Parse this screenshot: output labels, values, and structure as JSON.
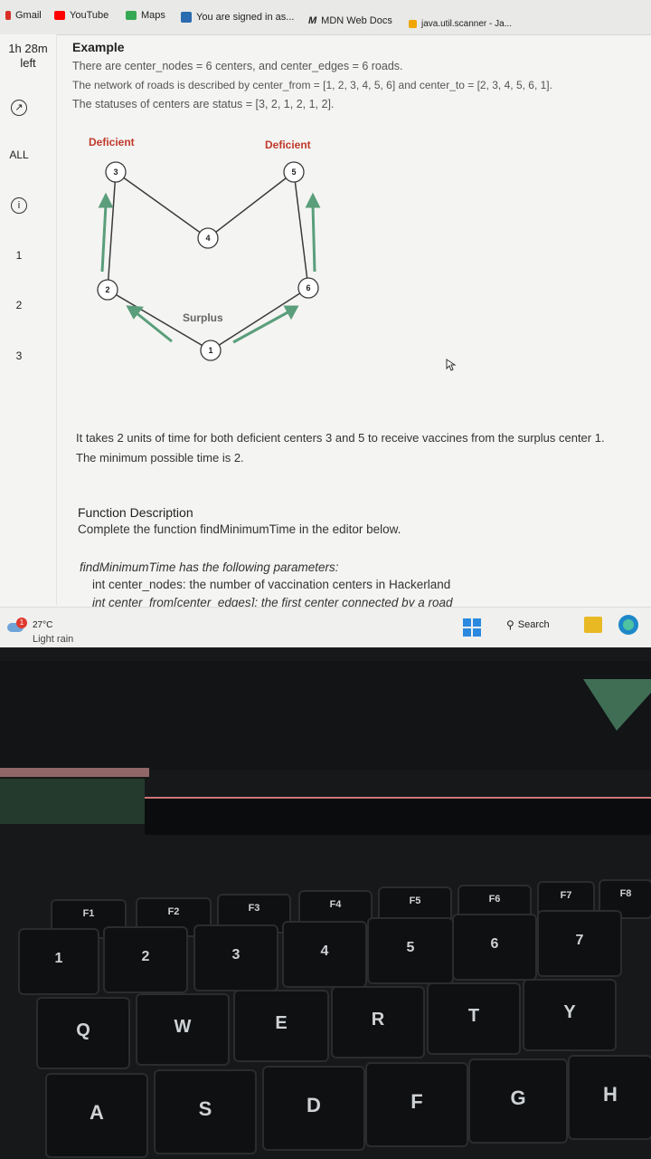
{
  "bookmarks": [
    {
      "label": "Gmail",
      "color": "#d93025"
    },
    {
      "label": "YouTube",
      "color": "#ff0000"
    },
    {
      "label": "Maps",
      "color": "#34a853"
    },
    {
      "label": "You are signed in as...",
      "color": "#2b6cb0"
    },
    {
      "label": "MDN Web Docs",
      "color": "#111111"
    },
    {
      "label": "java.util.scanner - Ja...",
      "color": "#f0a500"
    }
  ],
  "sidebar": {
    "timer_line1": "1h 28m",
    "timer_line2": "left",
    "all_label": "ALL",
    "info_glyph": "i",
    "questions": [
      "1",
      "2",
      "3"
    ]
  },
  "example": {
    "title": "Example",
    "line1": "There are center_nodes = 6 centers, and center_edges = 6 roads.",
    "line2": "The network of roads is described by center_from = [1, 2, 3, 4, 5, 6] and center_to = [2, 3, 4, 5, 6, 1].",
    "line3": "The statuses of centers are status = [3, 2, 1, 2, 1, 2]."
  },
  "diagram": {
    "labels": {
      "deficient_left": "Deficient",
      "deficient_right": "Deficient",
      "surplus": "Surplus"
    },
    "nodes": [
      "1",
      "2",
      "3",
      "4",
      "5",
      "6"
    ],
    "edge_color": "#3a3a3a",
    "arrow_color": "#5a9e7b",
    "label_color": "#c0392b"
  },
  "explanation": {
    "line1": "It takes 2 units of time for both deficient centers 3 and 5 to receive vaccines from the surplus center 1.",
    "line2": "The minimum possible time is 2."
  },
  "function_description": {
    "title": "Function Description",
    "line": "Complete the function findMinimumTime in the editor below."
  },
  "parameters": {
    "intro": "findMinimumTime has the following parameters:",
    "param1": "int center_nodes: the number of vaccination centers in Hackerland",
    "param2": "int center_from[center_edges]: the first center connected by a road"
  },
  "taskbar": {
    "weather_badge": "1",
    "temperature": "27°C",
    "weather": "Light rain",
    "search_label": "Search"
  },
  "keyboard": {
    "fn_row": [
      "F1",
      "F2",
      "F3",
      "F4",
      "F5",
      "F6",
      "F7",
      "F8"
    ],
    "num_row": [
      "1",
      "2",
      "3",
      "4",
      "5",
      "6",
      "7"
    ],
    "num_symbols": [
      "!",
      "@",
      "#",
      "$",
      "%",
      "^",
      "&"
    ],
    "top_row": [
      "Q",
      "W",
      "E",
      "R",
      "T",
      "Y"
    ],
    "home_row": [
      "A",
      "S",
      "D",
      "F",
      "G",
      "H"
    ]
  }
}
